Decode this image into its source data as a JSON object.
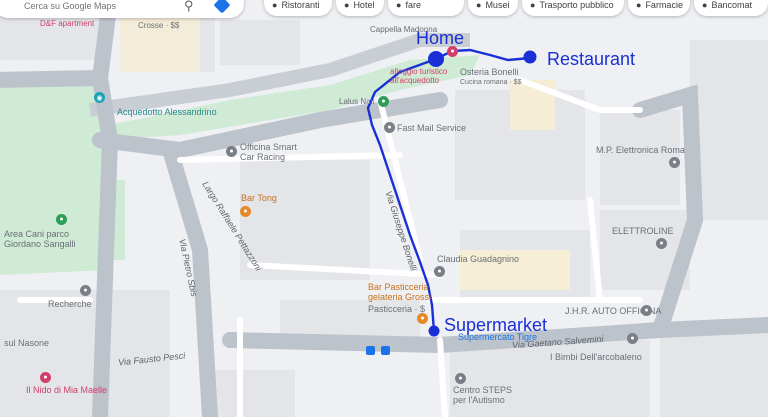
{
  "search": {
    "placeholder": "Cerca su Google Maps"
  },
  "chips": [
    {
      "icon": "fork-knife-icon",
      "glyph": "🍴",
      "label": "Ristoranti"
    },
    {
      "icon": "bed-icon",
      "glyph": "🛏",
      "label": "Hotel"
    },
    {
      "icon": "camera-icon",
      "glyph": "📷",
      "label": "Cose da fare"
    },
    {
      "icon": "museum-icon",
      "glyph": "🏛",
      "label": "Musei"
    },
    {
      "icon": "bus-icon",
      "glyph": "🚌",
      "label": "Trasporto pubblico"
    },
    {
      "icon": "pill-icon",
      "glyph": "💊",
      "label": "Farmacie"
    },
    {
      "icon": "cash-icon",
      "glyph": "💵",
      "label": "Bancomat"
    }
  ],
  "markers": {
    "home": "Home",
    "restaurant": "Restaurant",
    "supermarket": "Supermarket"
  },
  "places": {
    "acquedotto": "Acquedotto Alessandrino",
    "fast_mail": "Fast Mail Service",
    "officina": "Officina Smart\nCar Racing",
    "bar_tong": "Bar Tong",
    "elettronica": "M.P. Elettronica Roma",
    "elettroline": "ELETTROLINE",
    "claudia": "Claudia Guadagnino",
    "bar_pasticceria": "Bar Pasticceria\ngelateria Grossi",
    "pasticceria_sub": "Pasticceria · $",
    "jhr": "J.H.R. AUTO OFFICINA",
    "supermercato": "Supermercato Tigre",
    "bimbi": "I Bimbi Dell'arcobaleno",
    "centro_steps": "Centro STEPS\nper l'Autismo",
    "area_cani": "Area Cani parco\nGiordano Sangalli",
    "recherche": "Recherche",
    "nasone": "sul Nasone",
    "nido": "Il Nido di Mia Maelle",
    "osteria": "Osteria Bonelli",
    "osteria_sub": "Cucina romana · $$",
    "alloggio": "alloggio turistico\nall'acquedotto",
    "cappella": "Cappella Madonna",
    "crosse": "Crosse · $$",
    "dsf": "D&F apartment",
    "lalus": "Lalus Nail"
  },
  "streets": {
    "via_bonelli": "Via Giuseppe Bonelli",
    "largo_raffaele": "Largo Raffaele Pettazzoni",
    "via_pietro": "Via Pietro Sbis",
    "via_fausto": "Via Fausto Pesci",
    "via_gaetano": "Via Gaetano Salvemini"
  },
  "route_color": "#1a2fd6"
}
